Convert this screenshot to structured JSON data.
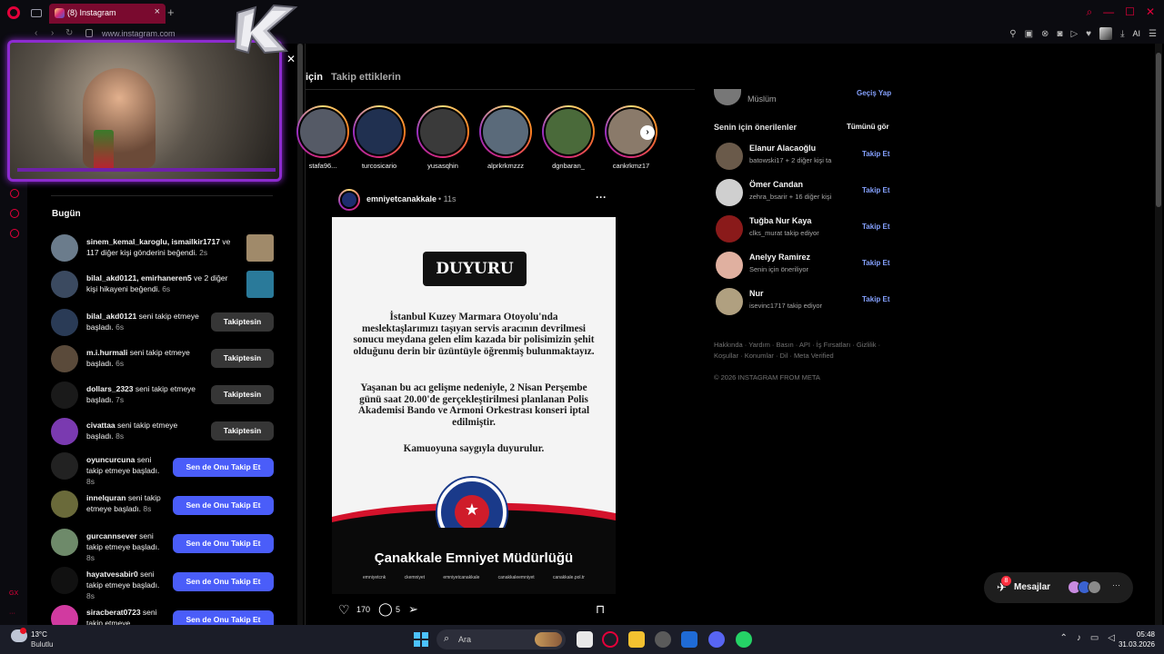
{
  "browser": {
    "tab_title": "(8) Instagram",
    "url": "www.instagram.com",
    "ai_label": "AI",
    "accent": "#e4003a"
  },
  "notifications": {
    "heading": "Bugün",
    "items": [
      {
        "user": "sinem_kemal_karoglu, ismailkir1717",
        "text": " ve 117 diğer kişi gönderini beğendi.",
        "time": "2s",
        "action": "thumb"
      },
      {
        "user": "bilal_akd0121, emirhaneren5",
        "text": " ve 2 diğer kişi hikayeni beğendi.",
        "time": "6s",
        "action": "thumb"
      },
      {
        "user": "bilal_akd0121",
        "text": " seni takip etmeye başladı.",
        "time": "6s",
        "action": "Takiptesin"
      },
      {
        "user": "m.i.hurmali",
        "text": " seni takip etmeye başladı.",
        "time": "6s",
        "action": "Takiptesin"
      },
      {
        "user": "dollars_2323",
        "text": " seni takip etmeye başladı.",
        "time": "7s",
        "action": "Takiptesin"
      },
      {
        "user": "civattaa",
        "text": " seni takip etmeye başladı.",
        "time": "8s",
        "action": "Takiptesin"
      },
      {
        "user": "oyuncurcuna",
        "text": " seni takip etmeye başladı.",
        "time": "8s",
        "action": "Sen de Onu Takip Et"
      },
      {
        "user": "innelquran",
        "text": " seni takip etmeye başladı.",
        "time": "8s",
        "action": "Sen de Onu Takip Et"
      },
      {
        "user": "gurcannsever",
        "text": " seni takip etmeye başladı.",
        "time": "8s",
        "action": "Sen de Onu Takip Et"
      },
      {
        "user": "hayatvesabir0",
        "text": " seni takip etmeye başladı.",
        "time": "8s",
        "action": "Sen de Onu Takip Et"
      },
      {
        "user": "siracberat0723",
        "text": " seni takip etmeye",
        "time": "",
        "action": "Sen de Onu Takip Et"
      }
    ]
  },
  "feed": {
    "tab_active": "için",
    "tab_other": "Takip ettiklerin",
    "stories": [
      "stafa96...",
      "turcosicario",
      "yusasqhin",
      "alprkrkmzzz",
      "dgnbaran_",
      "cankrkmz17"
    ],
    "post": {
      "user": "emniyetcanakkale",
      "time": "• 11s",
      "headline": "DUYURU",
      "paragraph1": "İstanbul Kuzey Marmara Otoyolu'nda meslektaşlarımızı taşıyan servis aracının devrilmesi sonucu meydana gelen elim kazada bir polisimizin şehit olduğunu derin bir üzüntüyle öğrenmiş bulunmaktayız.",
      "paragraph2": "Yaşanan bu acı gelişme nedeniyle, 2 Nisan Perşembe günü saat 20.00'de gerçekleştirilmesi planlanan Polis Akademisi Bando ve Armoni Orkestrası konseri iptal edilmiştir.",
      "paragraph3": "Kamuoyuna saygıyla duyurulur.",
      "org": "Çanakkale Emniyet Müdürlüğü",
      "socials": [
        "emniyetcnk",
        "ckemniyet",
        "emniyetcanakkale",
        "canakkaleemniyet",
        "canakkale.pol.tr"
      ],
      "likes": "170",
      "comments": "5"
    }
  },
  "sidebar": {
    "me_name": "Müslüm",
    "switch_label": "Geçiş Yap",
    "suggestions_title": "Senin için önerilenler",
    "see_all": "Tümünü gör",
    "follow_label": "Takip Et",
    "suggestions": [
      {
        "name": "Elanur Alacaoğlu",
        "sub": "batowski17 + 2 diğer kişi ta"
      },
      {
        "name": "Ömer Candan",
        "sub": "zehra_bsarir + 16 diğer kişi"
      },
      {
        "name": "Tuğba Nur Kaya",
        "sub": "clks_murat takip ediyor"
      },
      {
        "name": "Anelyy Ramirez",
        "sub": "Senin için öneriliyor"
      },
      {
        "name": "Nur",
        "sub": "isevinc1717 takip ediyor"
      }
    ],
    "footer_links": "Hakkında · Yardım · Basın · API · İş Fırsatları · Gizlilik · Koşullar · Konumlar · Dil · Meta Verified",
    "copyright": "© 2026 INSTAGRAM FROM META"
  },
  "messages": {
    "label": "Mesajlar",
    "badge": "8",
    "more": "···"
  },
  "taskbar": {
    "temp": "13°C",
    "weather": "Bulutlu",
    "search": "Ara",
    "time": "05:48",
    "date": "31.03.2026"
  }
}
